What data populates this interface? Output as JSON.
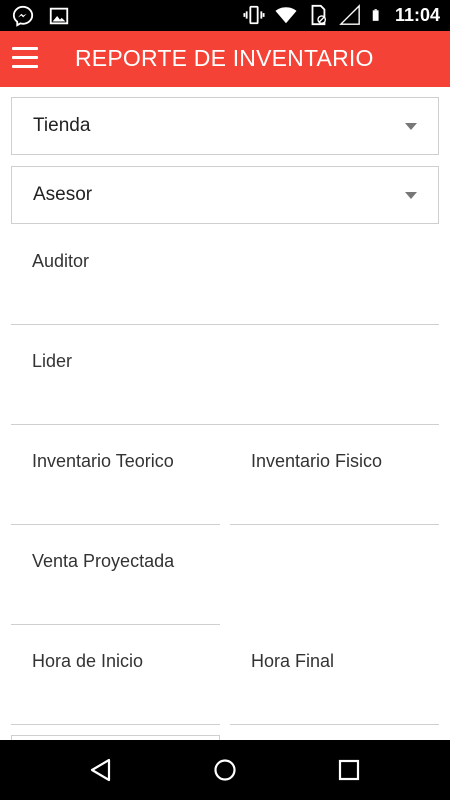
{
  "status_bar": {
    "time": "11:04",
    "left_icons": [
      "messenger-icon",
      "image-icon"
    ],
    "right_icons": [
      "vibrate-icon",
      "wifi-icon",
      "sim-icon",
      "signal-icon",
      "battery-icon"
    ]
  },
  "app_bar": {
    "title": "REPORTE DE INVENTARIO",
    "background": "#f44336"
  },
  "form": {
    "tienda": "Tienda",
    "asesor": "Asesor",
    "auditor": "Auditor",
    "lider": "Lider",
    "inventario_teorico": "Inventario Teorico",
    "inventario_fisico": "Inventario Fisico",
    "venta_proyectada": "Venta Proyectada",
    "hora_inicio": "Hora de Inicio",
    "hora_final": "Hora Final"
  },
  "nav_bar": {
    "buttons": [
      "back-icon",
      "home-icon",
      "recents-icon"
    ]
  }
}
